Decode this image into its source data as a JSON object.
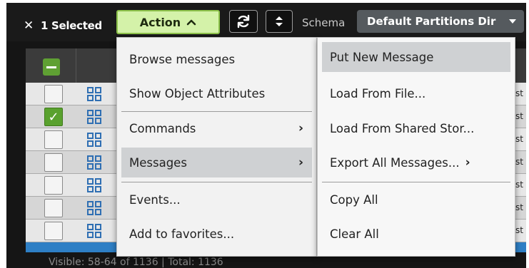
{
  "toolbar": {
    "selected_text": "1 Selected",
    "close_glyph": "✕",
    "action_label": "Action",
    "action_chevron": "⌃",
    "refresh_icon": "refresh-icon",
    "sort_icon": "sort-updown-icon",
    "schema_label": "Schema",
    "schema_value": "Default Partitions Dir"
  },
  "colors": {
    "action_bg": "#d4f2a9",
    "action_border": "#8dc24a",
    "check_green": "#59a12e",
    "menu_highlight": "#cfd1d3"
  },
  "action_menu": {
    "items": [
      {
        "label": "Browse messages",
        "submenu": false
      },
      {
        "label": "Show Object Attributes",
        "submenu": false
      },
      {
        "label": "Commands",
        "submenu": true
      },
      {
        "label": "Messages",
        "submenu": true,
        "highlighted": true
      },
      {
        "label": "Events...",
        "submenu": false
      },
      {
        "label": "Add to favorites...",
        "submenu": false
      }
    ]
  },
  "messages_submenu": {
    "items": [
      {
        "label": "Put New Message",
        "highlighted": true
      },
      {
        "label": "Load From File..."
      },
      {
        "label": "Load From Shared Stor..."
      },
      {
        "label": "Export All Messages...",
        "submenu": true
      },
      {
        "label": "Copy All"
      },
      {
        "label": "Clear All"
      }
    ]
  },
  "table": {
    "row_count_visible": 7,
    "checked_row_index": 1,
    "right_col_fragments": [
      "st",
      "st",
      "st",
      "st",
      "st",
      "st",
      "st"
    ]
  },
  "footer": {
    "visible_text": "Visible: 58-64 of 1136 | Total: 1136"
  }
}
